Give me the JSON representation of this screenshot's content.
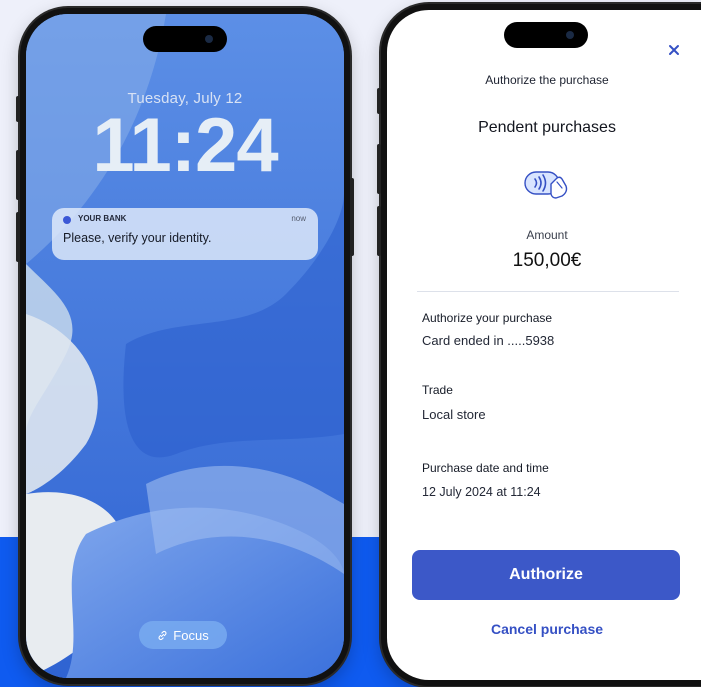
{
  "lock_screen": {
    "date": "Tuesday, July 12",
    "time": "11:24",
    "notification": {
      "app": "YOUR BANK",
      "time": "now",
      "message": "Please, verify your identity."
    },
    "focus_label": "Focus",
    "focus_icon": "link-icon"
  },
  "authorize_screen": {
    "close_icon": "close-icon",
    "title": "Authorize the purchase",
    "subtitle": "Pendent purchases",
    "payment_icon": "contactless-payment-icon",
    "amount_label": "Amount",
    "amount_value": "150,00€",
    "details": [
      {
        "label": "Authorize your purchase",
        "value": "Card ended in .....5938"
      },
      {
        "label": "Trade",
        "value": "Local store"
      },
      {
        "label": "Purchase date and time",
        "value": "12 July 2024 at 11:24"
      }
    ],
    "authorize_button": "Authorize",
    "cancel_link": "Cancel purchase"
  },
  "colors": {
    "background": "#eef0fa",
    "band": "#0f5bf0",
    "primary_button": "#3c58c8",
    "link": "#3550c4"
  }
}
